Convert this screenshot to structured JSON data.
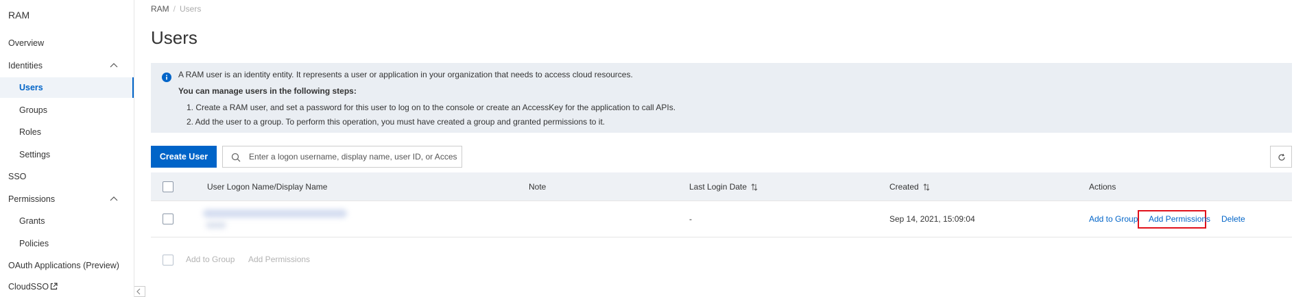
{
  "sidebar": {
    "title": "RAM",
    "items": [
      {
        "label": "Overview"
      },
      {
        "label": "Identities"
      },
      {
        "label": "Users"
      },
      {
        "label": "Groups"
      },
      {
        "label": "Roles"
      },
      {
        "label": "Settings"
      },
      {
        "label": "SSO"
      },
      {
        "label": "Permissions"
      },
      {
        "label": "Grants"
      },
      {
        "label": "Policies"
      },
      {
        "label": "OAuth Applications (Preview)"
      },
      {
        "label": "CloudSSO"
      }
    ],
    "active_item": "Users"
  },
  "breadcrumb": {
    "root": "RAM",
    "separator": "/",
    "current": "Users"
  },
  "page": {
    "title": "Users"
  },
  "info_box": {
    "line1": "A RAM user is an identity entity. It represents a user or application in your organization that needs to access cloud resources.",
    "line2": "You can manage users in the following steps:",
    "line3": "1. Create a RAM user, and set a password for this user to log on to the console or create an AccessKey for the application to call APIs.",
    "line4": "2. Add the user to a group. To perform this operation, you must have created a group and granted permissions to it."
  },
  "toolbar": {
    "create_user_label": "Create User",
    "search_placeholder": "Enter a logon username, display name, user ID, or Acces"
  },
  "table": {
    "columns": [
      {
        "label": "User Logon Name/Display Name"
      },
      {
        "label": "Note"
      },
      {
        "label": "Last Login Date"
      },
      {
        "label": "Created"
      },
      {
        "label": "Actions"
      }
    ],
    "rows": [
      {
        "name": "",
        "note": "",
        "last_login": "-",
        "created": "Sep 14, 2021, 15:09:04",
        "actions": [
          "Add to Group",
          "Add Permissions",
          "Delete"
        ]
      }
    ]
  },
  "bulk_actions": {
    "add_to_group": "Add to Group",
    "add_permissions": "Add Permissions"
  },
  "colors": {
    "accent": "#0064c8",
    "highlight": "#e0101a",
    "info_bg": "#eaeef3"
  }
}
